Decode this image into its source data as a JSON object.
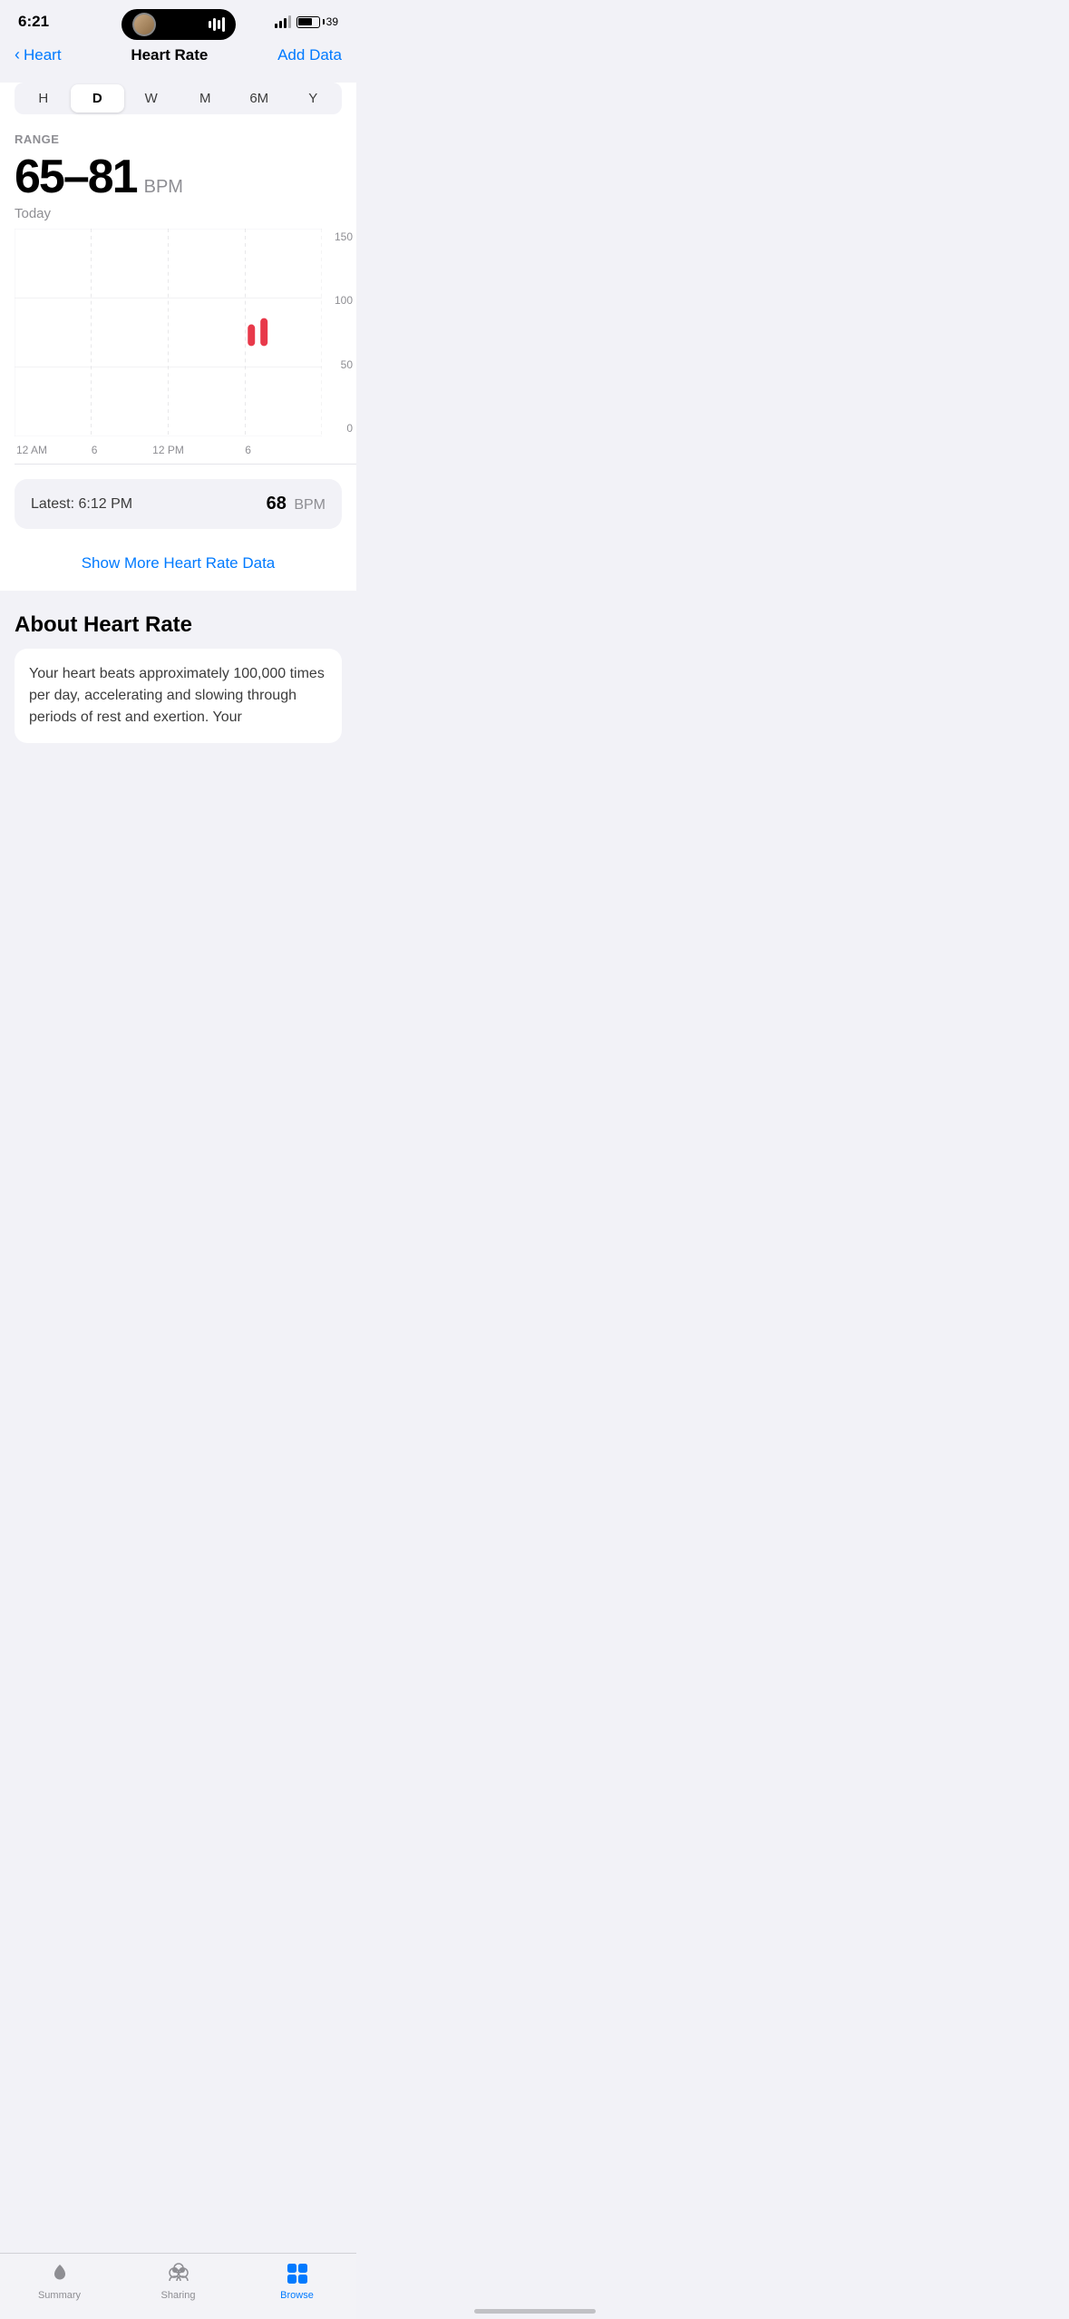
{
  "statusBar": {
    "time": "6:21",
    "batteryPercent": "39"
  },
  "nav": {
    "backLabel": "Heart",
    "title": "Heart Rate",
    "actionLabel": "Add Data"
  },
  "periodSelector": {
    "options": [
      "H",
      "D",
      "W",
      "M",
      "6M",
      "Y"
    ],
    "active": "D"
  },
  "chart": {
    "rangeLabel": "RANGE",
    "bpmRange": "65–81",
    "bpmUnit": "BPM",
    "dateLabel": "Today",
    "yLabels": [
      "150",
      "100",
      "50",
      "0"
    ],
    "xLabels": [
      {
        "text": "12 AM",
        "position": "2%"
      },
      {
        "text": "6",
        "position": "27%"
      },
      {
        "text": "12 PM",
        "position": "52%"
      },
      {
        "text": "6",
        "position": "77%"
      }
    ]
  },
  "latestReading": {
    "label": "Latest: 6:12 PM",
    "value": "68",
    "unit": "BPM"
  },
  "showMore": {
    "label": "Show More Heart Rate Data"
  },
  "about": {
    "title": "About Heart Rate",
    "text": "Your heart beats approximately 100,000 times per day, accelerating and slowing through periods of rest and exertion. Your"
  },
  "tabBar": {
    "tabs": [
      {
        "id": "summary",
        "label": "Summary",
        "active": false
      },
      {
        "id": "sharing",
        "label": "Sharing",
        "active": false
      },
      {
        "id": "browse",
        "label": "Browse",
        "active": true
      }
    ]
  }
}
